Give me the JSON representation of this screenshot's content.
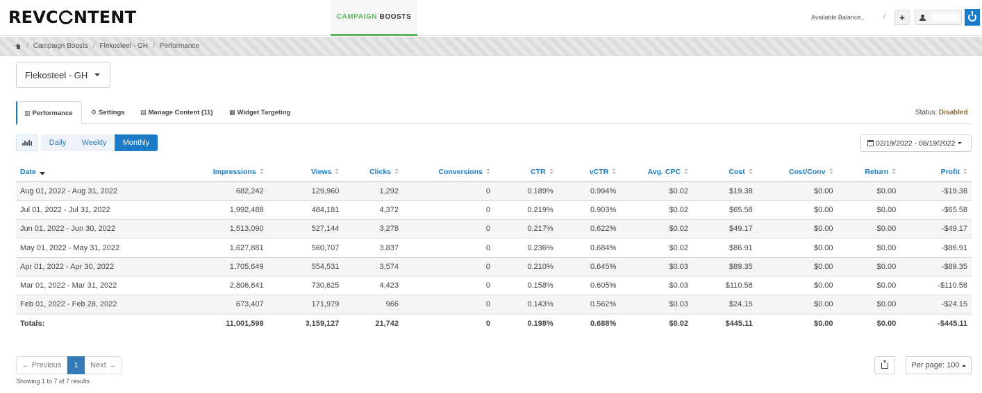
{
  "header": {
    "logo_left": "REVC",
    "logo_right": "NTENT",
    "nav_green": "CAMPAIGN",
    "nav_dark": "BOOSTS",
    "balance_label": "Available Balance..",
    "balance_caret": "⁄",
    "plus": "+"
  },
  "breadcrumb": {
    "items": [
      "Campaign Boosts",
      "Flekosteel - GH",
      "Performance"
    ],
    "separator": "/"
  },
  "campaign": {
    "selected": "Flekosteel - GH"
  },
  "tabs": [
    {
      "label": "Performance",
      "icon": "bar-chart-icon",
      "glyph": "▥"
    },
    {
      "label": "Settings",
      "icon": "gear-icon",
      "glyph": "⚙"
    },
    {
      "label": "Manage Content (11)",
      "icon": "file-icon",
      "glyph": "▤"
    },
    {
      "label": "Widget Targeting",
      "icon": "grid-icon",
      "glyph": "▦"
    }
  ],
  "status": {
    "label": "Status:",
    "value": "Disabled"
  },
  "period": {
    "daily": "Daily",
    "weekly": "Weekly",
    "monthly": "Monthly",
    "active": "Monthly"
  },
  "date_range": "02/19/2022 - 08/19/2022",
  "table": {
    "columns": [
      "Date",
      "Impressions",
      "Views",
      "Clicks",
      "Conversions",
      "CTR",
      "vCTR",
      "Avg. CPC",
      "Cost",
      "Cost/Conv",
      "Return",
      "Profit"
    ],
    "rows": [
      [
        "Aug 01, 2022 - Aug 31, 2022",
        "682,242",
        "129,960",
        "1,292",
        "0",
        "0.189%",
        "0.994%",
        "$0.02",
        "$19.38",
        "$0.00",
        "$0.00",
        "-$19.38"
      ],
      [
        "Jul 01, 2022 - Jul 31, 2022",
        "1,992,488",
        "484,181",
        "4,372",
        "0",
        "0.219%",
        "0.903%",
        "$0.02",
        "$65.58",
        "$0.00",
        "$0.00",
        "-$65.58"
      ],
      [
        "Jun 01, 2022 - Jun 30, 2022",
        "1,513,090",
        "527,144",
        "3,278",
        "0",
        "0.217%",
        "0.622%",
        "$0.02",
        "$49.17",
        "$0.00",
        "$0.00",
        "-$49.17"
      ],
      [
        "May 01, 2022 - May 31, 2022",
        "1,627,881",
        "560,707",
        "3,837",
        "0",
        "0.236%",
        "0.684%",
        "$0.02",
        "$86.91",
        "$0.00",
        "$0.00",
        "-$86.91"
      ],
      [
        "Apr 01, 2022 - Apr 30, 2022",
        "1,705,649",
        "554,531",
        "3,574",
        "0",
        "0.210%",
        "0.645%",
        "$0.03",
        "$89.35",
        "$0.00",
        "$0.00",
        "-$89.35"
      ],
      [
        "Mar 01, 2022 - Mar 31, 2022",
        "2,806,841",
        "730,625",
        "4,423",
        "0",
        "0.158%",
        "0.605%",
        "$0.03",
        "$110.58",
        "$0.00",
        "$0.00",
        "-$110.58"
      ],
      [
        "Feb 01, 2022 - Feb 28, 2022",
        "673,407",
        "171,979",
        "966",
        "0",
        "0.143%",
        "0.562%",
        "$0.03",
        "$24.15",
        "$0.00",
        "$0.00",
        "-$24.15"
      ]
    ],
    "totals": [
      "Totals:",
      "11,001,598",
      "3,159,127",
      "21,742",
      "0",
      "0.198%",
      "0.688%",
      "$0.02",
      "$445.11",
      "$0.00",
      "$0.00",
      "-$445.11"
    ],
    "column_styles": [
      "",
      "",
      "",
      "",
      "",
      "",
      "",
      "pos",
      "pos",
      "",
      "",
      "neg"
    ]
  },
  "pagination": {
    "prev": "← Previous",
    "page": "1",
    "next": "Next →",
    "showing": "Showing 1 to 7 of 7 results",
    "per_page": "Per page: 100"
  },
  "colors": {
    "accent": "#1a7cc8",
    "brand_green": "#5cb85c",
    "positive": "#3c8d3c",
    "negative": "#c9302c",
    "status": "#8a6d3b"
  }
}
